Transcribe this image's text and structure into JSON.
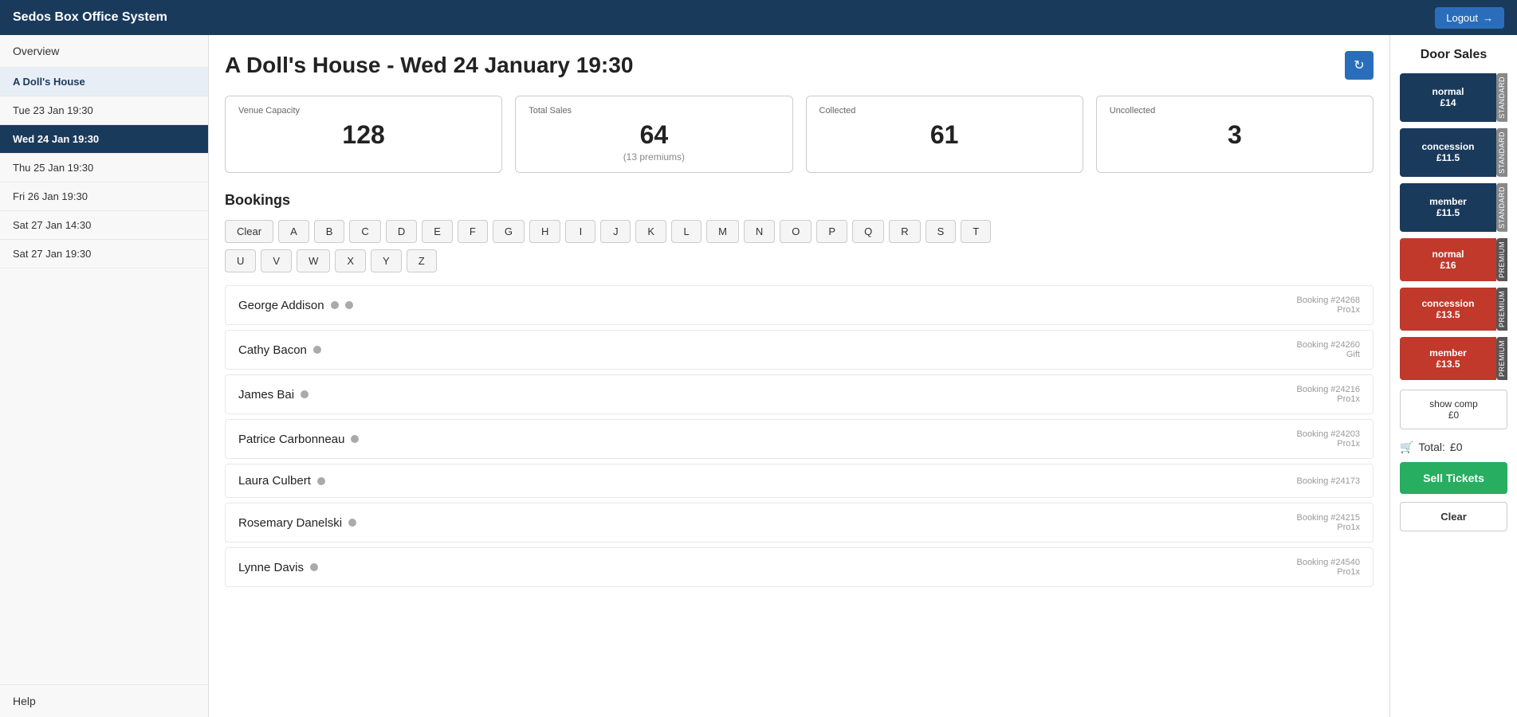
{
  "app": {
    "title": "Sedos Box Office System",
    "logout_label": "Logout"
  },
  "sidebar": {
    "overview_label": "Overview",
    "show_label": "A Doll's House",
    "performances": [
      {
        "label": "Tue 23 Jan 19:30",
        "active": false
      },
      {
        "label": "Wed 24 Jan 19:30",
        "active": true
      },
      {
        "label": "Thu 25 Jan 19:30",
        "active": false
      },
      {
        "label": "Fri 26 Jan 19:30",
        "active": false
      },
      {
        "label": "Sat 27 Jan 14:30",
        "active": false
      },
      {
        "label": "Sat 27 Jan 19:30",
        "active": false
      }
    ],
    "help_label": "Help"
  },
  "page": {
    "title": "A Doll's House - Wed 24 January 19:30"
  },
  "stats": {
    "venue_capacity_label": "Venue Capacity",
    "venue_capacity_value": "128",
    "total_sales_label": "Total Sales",
    "total_sales_value": "64",
    "total_sales_sub": "(13 premiums)",
    "collected_label": "Collected",
    "collected_value": "61",
    "uncollected_label": "Uncollected",
    "uncollected_value": "3"
  },
  "bookings": {
    "section_title": "Bookings",
    "filter_clear": "Clear",
    "filter_letters": [
      "A",
      "B",
      "C",
      "D",
      "E",
      "F",
      "G",
      "H",
      "I",
      "J",
      "K",
      "L",
      "M",
      "N",
      "O",
      "P",
      "Q",
      "R",
      "S",
      "T",
      "U",
      "V",
      "W",
      "X",
      "Y",
      "Z"
    ],
    "items": [
      {
        "name": "George Addison",
        "collected": false,
        "booking_ref": "Booking #24268",
        "booking_sub": "Pro1x"
      },
      {
        "name": "Cathy Bacon",
        "collected": false,
        "booking_ref": "Booking #24260",
        "booking_sub": "Gift"
      },
      {
        "name": "James Bai",
        "collected": false,
        "booking_ref": "Booking #24216",
        "booking_sub": "Pro1x"
      },
      {
        "name": "Patrice Carbonneau",
        "collected": false,
        "booking_ref": "Booking #24203",
        "booking_sub": "Pro1x"
      },
      {
        "name": "Laura Culbert",
        "collected": false,
        "booking_ref": "Booking #24173",
        "booking_sub": ""
      },
      {
        "name": "Rosemary Danelski",
        "collected": false,
        "booking_ref": "Booking #24215",
        "booking_sub": "Pro1x"
      },
      {
        "name": "Lynne Davis",
        "collected": false,
        "booking_ref": "Booking #24540",
        "booking_sub": "Pro1x"
      }
    ]
  },
  "door_sales": {
    "title": "Door Sales",
    "buttons": [
      {
        "label": "normal",
        "sub": "£14",
        "type": "dark-blue",
        "tag": "STANDARD"
      },
      {
        "label": "concession",
        "sub": "£11.5",
        "type": "dark-blue",
        "tag": "STANDARD"
      },
      {
        "label": "member",
        "sub": "£11.5",
        "type": "dark-blue",
        "tag": "STANDARD"
      },
      {
        "label": "normal",
        "sub": "£16",
        "type": "red",
        "tag": "PREMIUM"
      },
      {
        "label": "concession",
        "sub": "£13.5",
        "type": "red",
        "tag": "PREMIUM"
      },
      {
        "label": "member",
        "sub": "£13.5",
        "type": "red",
        "tag": "PREMIUM"
      }
    ],
    "show_comp_label": "show comp",
    "show_comp_price": "£0",
    "total_label": "Total:",
    "total_value": "£0",
    "sell_tickets_label": "Sell Tickets",
    "clear_label": "Clear"
  }
}
